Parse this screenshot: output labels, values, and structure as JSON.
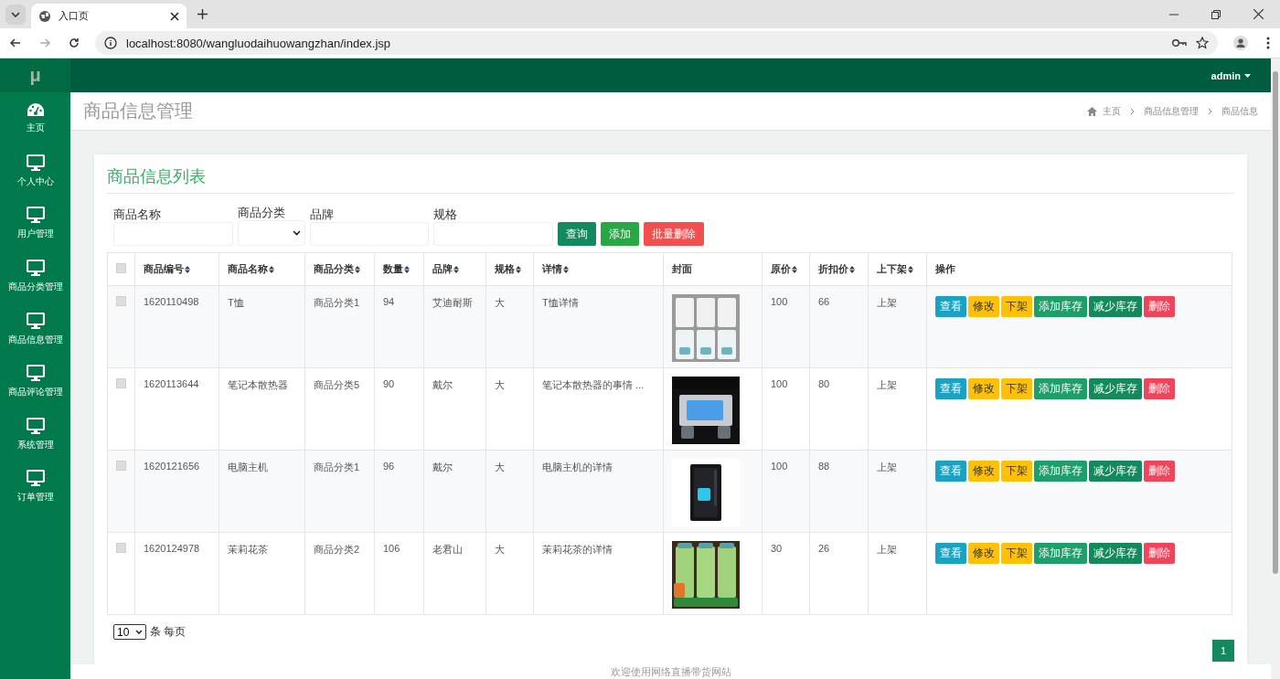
{
  "browser": {
    "tab_title": "入口页",
    "url": "localhost:8080/wangluodaihuowangzhan/index.jsp"
  },
  "sidebar": {
    "logo": "μ",
    "items": [
      {
        "label": "主页"
      },
      {
        "label": "个人中心"
      },
      {
        "label": "用户管理"
      },
      {
        "label": "商品分类管理"
      },
      {
        "label": "商品信息管理"
      },
      {
        "label": "商品评论管理"
      },
      {
        "label": "系统管理"
      },
      {
        "label": "订单管理"
      }
    ]
  },
  "topbar": {
    "user": "admin"
  },
  "page_header": {
    "title": "商品信息管理",
    "breadcrumb": [
      "主页",
      "商品信息管理",
      "商品信息"
    ]
  },
  "card": {
    "title": "商品信息列表",
    "filters": [
      {
        "label": "商品名称",
        "kind": "input"
      },
      {
        "label": "商品分类",
        "kind": "select"
      },
      {
        "label": "品牌",
        "kind": "input"
      },
      {
        "label": "规格",
        "kind": "input"
      }
    ],
    "buttons": [
      {
        "label": "查询",
        "kind": "search"
      },
      {
        "label": "添加",
        "kind": "add"
      },
      {
        "label": "批量删除",
        "kind": "delete"
      }
    ],
    "table": {
      "select_all_checked": false,
      "columns": [
        {
          "label": "商品编号",
          "sortable": true
        },
        {
          "label": "商品名称",
          "sortable": true
        },
        {
          "label": "商品分类",
          "sortable": true
        },
        {
          "label": "数量",
          "sortable": true
        },
        {
          "label": "品牌",
          "sortable": true
        },
        {
          "label": "规格",
          "sortable": true
        },
        {
          "label": "详情",
          "sortable": true
        },
        {
          "label": "封面",
          "sortable": false
        },
        {
          "label": "原价",
          "sortable": true
        },
        {
          "label": "折扣价",
          "sortable": true
        },
        {
          "label": "上下架",
          "sortable": true
        },
        {
          "label": "操作",
          "sortable": false
        }
      ],
      "rows": [
        {
          "checked": false,
          "cells": [
            "1620110498",
            "T恤",
            "商品分类1",
            "94",
            "艾迪耐斯",
            "大",
            "T恤详情"
          ],
          "after": [
            "100",
            "66",
            "上架"
          ],
          "actions": [
            {
              "label": "查看",
              "kind": "view"
            },
            {
              "label": "修改",
              "kind": "edit"
            },
            {
              "label": "下架",
              "kind": "shelf"
            },
            {
              "label": "添加库存",
              "kind": "add"
            },
            {
              "label": "减少库存",
              "kind": "reduce"
            },
            {
              "label": "删除",
              "kind": "delete"
            }
          ]
        },
        {
          "checked": false,
          "cells": [
            "1620113644",
            "笔记本散热器",
            "商品分类5",
            "90",
            "戴尔",
            "大",
            "笔记本散热器的事情 ..."
          ],
          "after": [
            "100",
            "80",
            "上架"
          ],
          "actions": [
            {
              "label": "查看",
              "kind": "view"
            },
            {
              "label": "修改",
              "kind": "edit"
            },
            {
              "label": "下架",
              "kind": "shelf"
            },
            {
              "label": "添加库存",
              "kind": "add"
            },
            {
              "label": "减少库存",
              "kind": "reduce"
            },
            {
              "label": "删除",
              "kind": "delete"
            }
          ]
        },
        {
          "checked": false,
          "cells": [
            "1620121656",
            "电脑主机",
            "商品分类1",
            "96",
            "戴尔",
            "大",
            "电脑主机的详情"
          ],
          "after": [
            "100",
            "88",
            "上架"
          ],
          "actions": [
            {
              "label": "查看",
              "kind": "view"
            },
            {
              "label": "修改",
              "kind": "edit"
            },
            {
              "label": "下架",
              "kind": "shelf"
            },
            {
              "label": "添加库存",
              "kind": "add"
            },
            {
              "label": "减少库存",
              "kind": "reduce"
            },
            {
              "label": "删除",
              "kind": "delete"
            }
          ]
        },
        {
          "checked": false,
          "cells": [
            "1620124978",
            "茉莉花茶",
            "商品分类2",
            "106",
            "老君山",
            "大",
            "茉莉花茶的详情"
          ],
          "after": [
            "30",
            "26",
            "上架"
          ],
          "actions": [
            {
              "label": "查看",
              "kind": "view"
            },
            {
              "label": "修改",
              "kind": "edit"
            },
            {
              "label": "下架",
              "kind": "shelf"
            },
            {
              "label": "添加库存",
              "kind": "add"
            },
            {
              "label": "减少库存",
              "kind": "reduce"
            },
            {
              "label": "删除",
              "kind": "delete"
            }
          ]
        }
      ]
    },
    "page_size": "10",
    "page_size_label": "条 每页",
    "pages": [
      {
        "label": "1",
        "selected": true
      }
    ]
  },
  "footer": "欢迎使用网络直播带货网站"
}
